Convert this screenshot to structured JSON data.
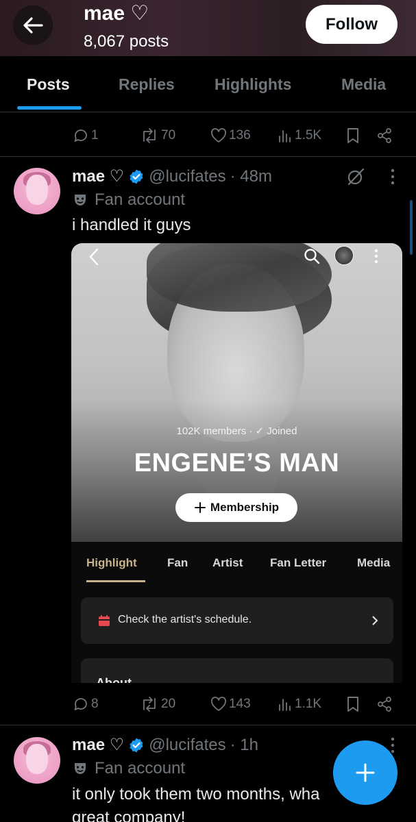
{
  "header": {
    "title": "mae ♡",
    "posts_count": "8,067 posts",
    "follow_label": "Follow"
  },
  "tabs": [
    {
      "label": "Posts",
      "active": true
    },
    {
      "label": "Replies",
      "active": false
    },
    {
      "label": "Highlights",
      "active": false
    },
    {
      "label": "Media",
      "active": false
    }
  ],
  "previous_post_actions": {
    "replies": "1",
    "reposts": "70",
    "likes": "136",
    "views": "1.5K"
  },
  "post1": {
    "display_name": "mae ♡",
    "handle": "@lucifates",
    "time": "· 48m",
    "badge_label": "Fan account",
    "text": "i handled it guys",
    "media": {
      "members_text": "102K members · ✓ Joined",
      "community_name": "ENGENE’S MAN",
      "membership_label": "Membership",
      "tabs": [
        "Highlight",
        "Fan",
        "Artist",
        "Fan Letter",
        "Media"
      ],
      "active_tab": "Highlight",
      "schedule_text": "Check the artist's schedule.",
      "about_text": "About"
    },
    "actions": {
      "replies": "8",
      "reposts": "20",
      "likes": "143",
      "views": "1.1K"
    }
  },
  "post2": {
    "display_name": "mae ♡",
    "handle": "@lucifates",
    "time": "· 1h",
    "badge_label": "Fan account",
    "text_line1": "it only took them two months, wha",
    "text_line2": "great company!"
  },
  "colors": {
    "accent": "#1d9bf0",
    "muted": "#71767b",
    "text": "#e7e9ea",
    "background": "#000000"
  }
}
